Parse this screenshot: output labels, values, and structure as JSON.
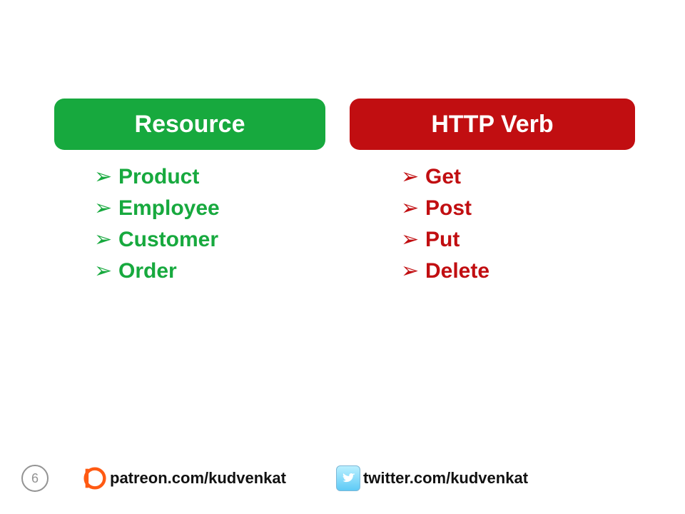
{
  "colors": {
    "green": "#17a93e",
    "red": "#c10e11"
  },
  "left": {
    "title": "Resource",
    "items": [
      "Product",
      "Employee",
      "Customer",
      "Order"
    ]
  },
  "right": {
    "title": "HTTP Verb",
    "items": [
      "Get",
      "Post",
      "Put",
      "Delete"
    ]
  },
  "footer": {
    "page": "6",
    "patreon": "patreon.com/kudvenkat",
    "twitter": "twitter.com/kudvenkat"
  }
}
